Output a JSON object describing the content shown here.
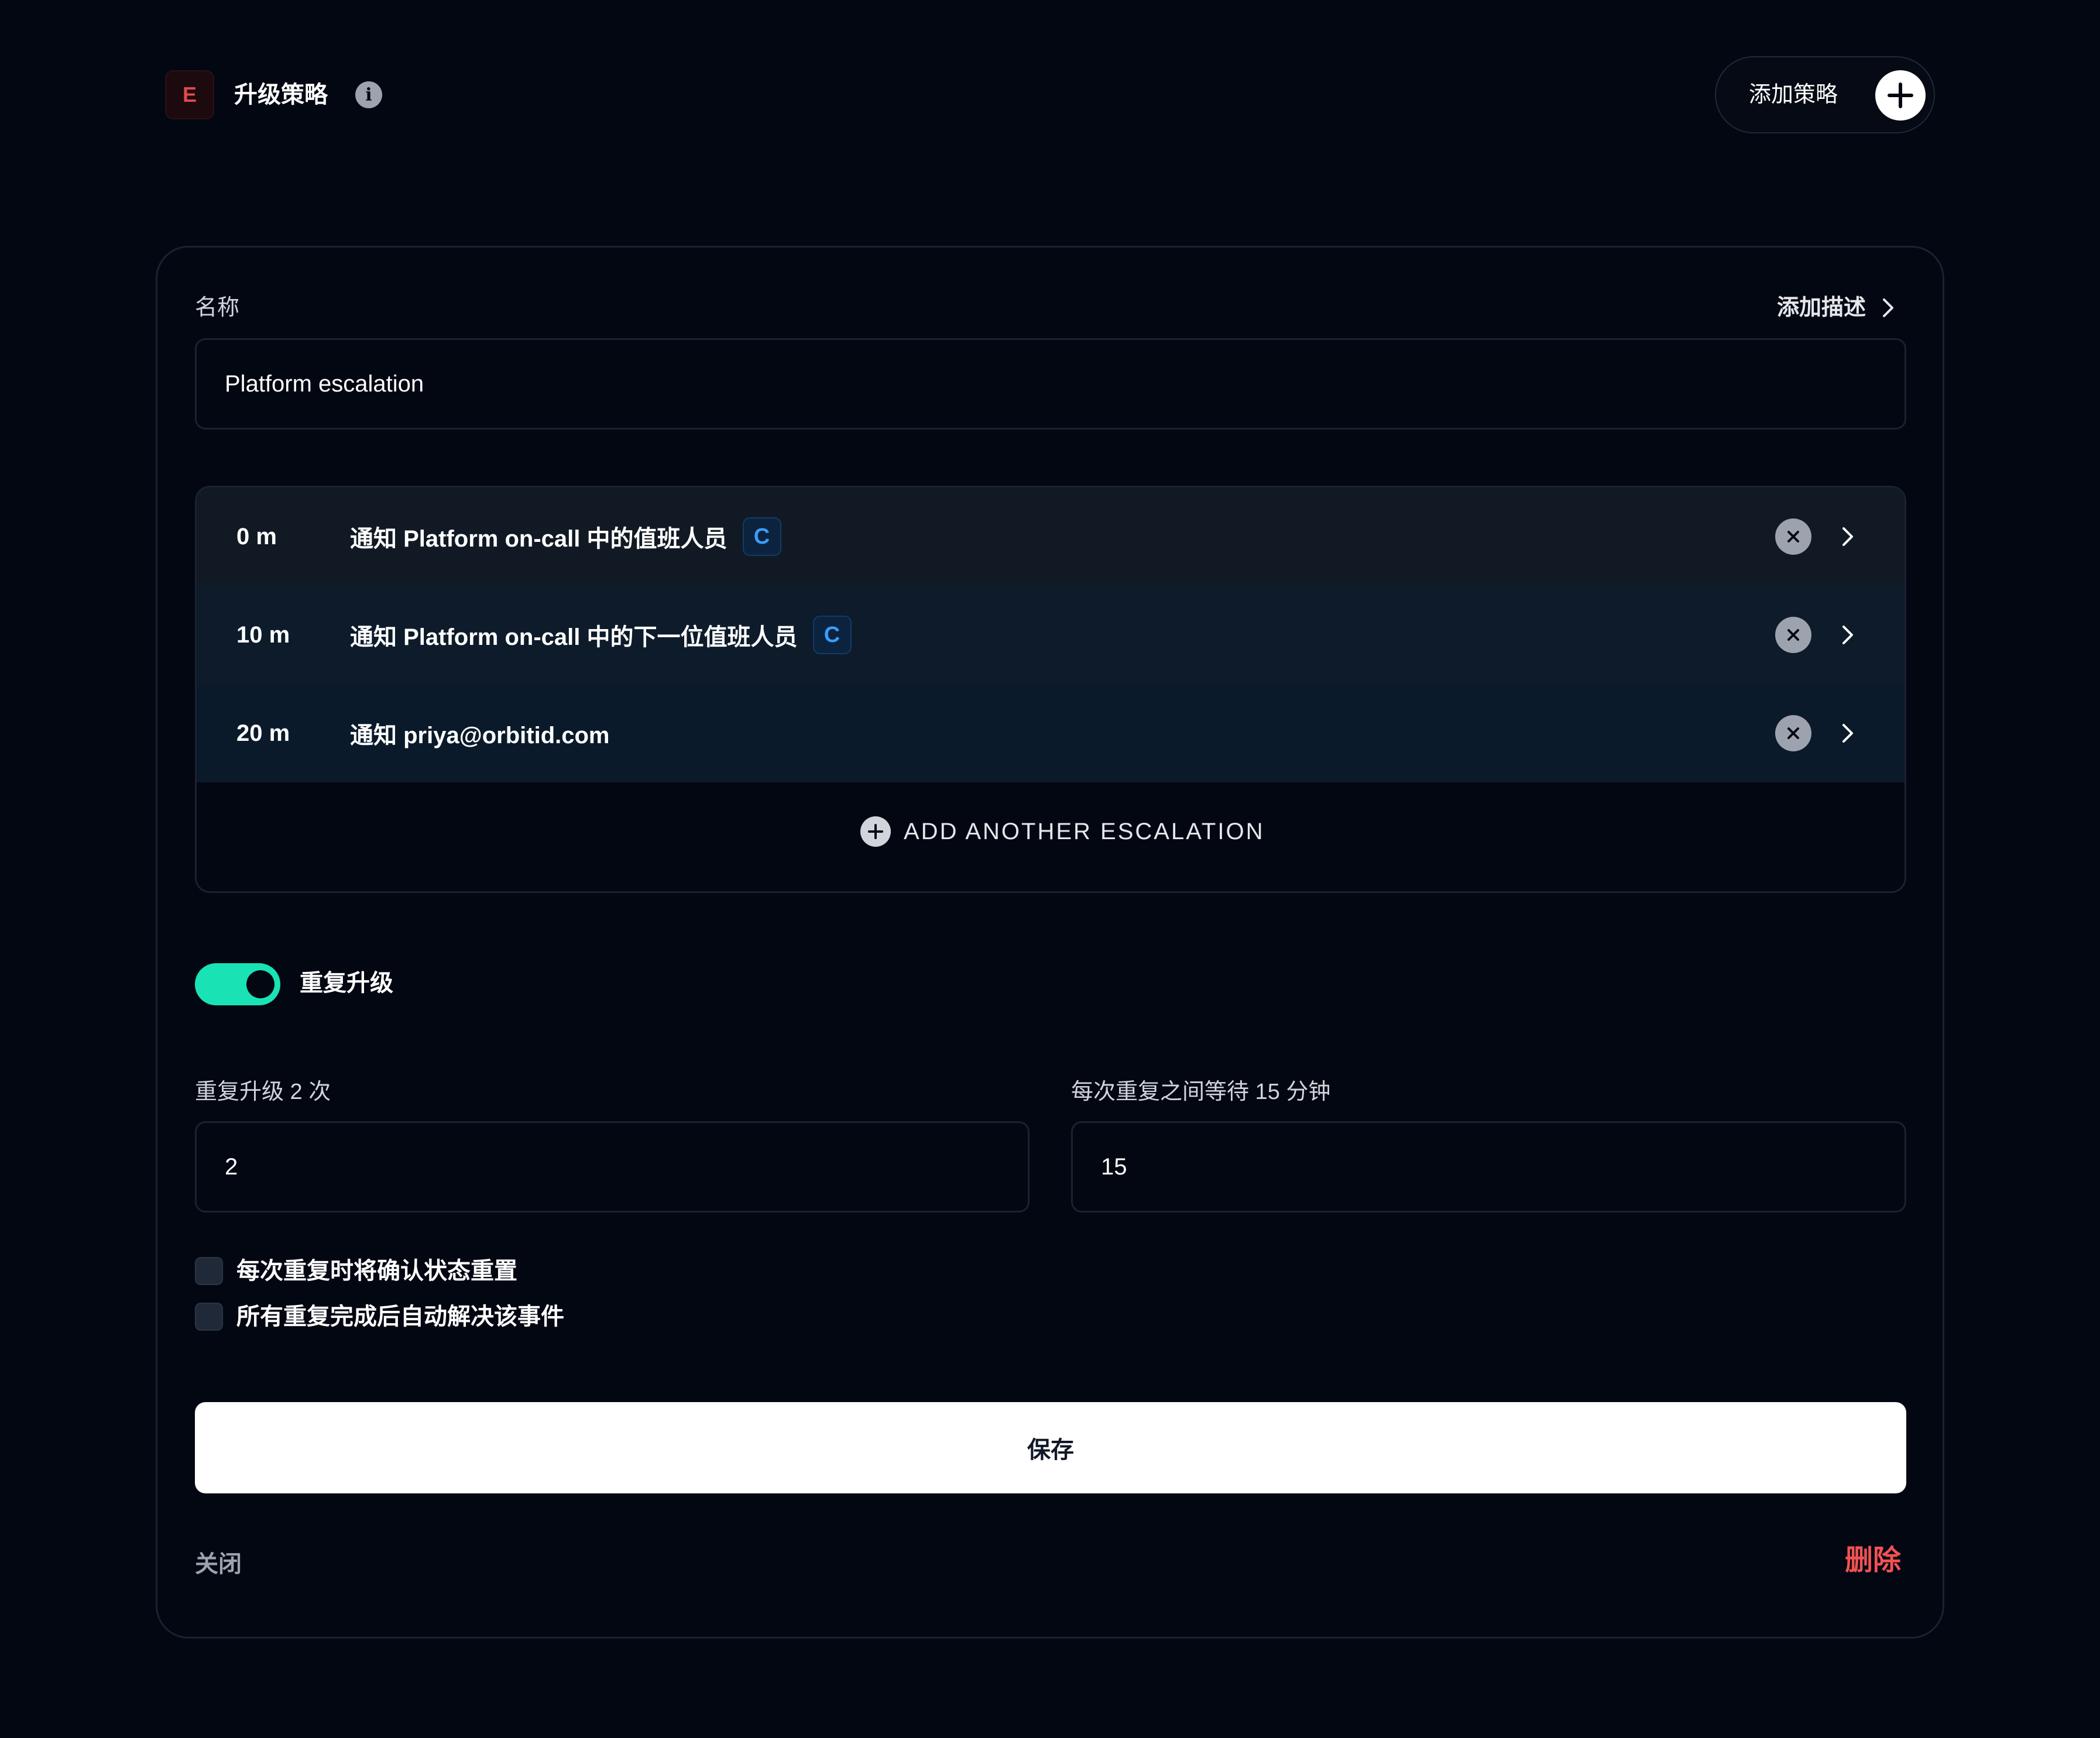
{
  "header": {
    "badge": "E",
    "title": "升级策略",
    "info_icon": "info-icon",
    "add_policy_label": "添加策略"
  },
  "form": {
    "name_label": "名称",
    "add_description_label": "添加描述",
    "name_value": "Platform escalation",
    "escalations": [
      {
        "time": "0 m",
        "text": "通知 Platform on-call 中的值班人员",
        "badge": "C"
      },
      {
        "time": "10 m",
        "text": "通知 Platform on-call 中的下一位值班人员",
        "badge": "C"
      },
      {
        "time": "20 m",
        "text": "通知 priya@orbitid.com",
        "badge": ""
      }
    ],
    "add_escalation_label": "ADD ANOTHER ESCALATION",
    "repeat_toggle_label": "重复升级",
    "repeat_toggle_on": true,
    "repeat_count_label": "重复升级 2 次",
    "repeat_count_value": "2",
    "repeat_wait_label": "每次重复之间等待 15 分钟",
    "repeat_wait_value": "15",
    "checkbox_reset_ack": "每次重复时将确认状态重置",
    "checkbox_auto_resolve": "所有重复完成后自动解决该事件",
    "save_label": "保存",
    "close_label": "关闭",
    "delete_label": "删除"
  },
  "colors": {
    "background": "#030712",
    "accent_toggle": "#19e3b5",
    "delete": "#f05252",
    "badge_blue": "#3b9cf6",
    "header_badge_red": "#e0484f"
  }
}
